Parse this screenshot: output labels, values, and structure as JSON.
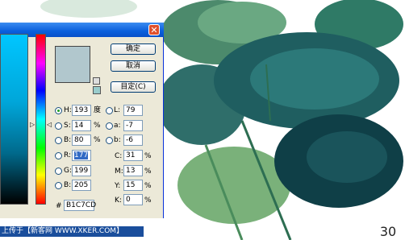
{
  "dialog": {
    "buttons": {
      "ok": "确定",
      "cancel": "取消",
      "custom": "目定(C)"
    },
    "hsb": [
      {
        "label": "H:",
        "value": "193",
        "unit": "度",
        "selected": true
      },
      {
        "label": "S:",
        "value": "14",
        "unit": "%",
        "selected": false
      },
      {
        "label": "B:",
        "value": "80",
        "unit": "%",
        "selected": false
      }
    ],
    "rgb": [
      {
        "label": "R:",
        "value": "177"
      },
      {
        "label": "G:",
        "value": "199"
      },
      {
        "label": "B:",
        "value": "205"
      }
    ],
    "lab": [
      {
        "label": "L:",
        "value": "79"
      },
      {
        "label": "a:",
        "value": "-7"
      },
      {
        "label": "b:",
        "value": "-6"
      }
    ],
    "cmyk": [
      {
        "label": "C:",
        "value": "31",
        "unit": "%"
      },
      {
        "label": "M:",
        "value": "13",
        "unit": "%"
      },
      {
        "label": "Y:",
        "value": "15",
        "unit": "%"
      },
      {
        "label": "K:",
        "value": "0",
        "unit": "%"
      }
    ],
    "hex_label": "#",
    "hex_value": "B1C7CD",
    "current_color": "#b1c7cd"
  },
  "caption": "上传于【新客网 WWW.XKER.COM】",
  "page_number": "30"
}
